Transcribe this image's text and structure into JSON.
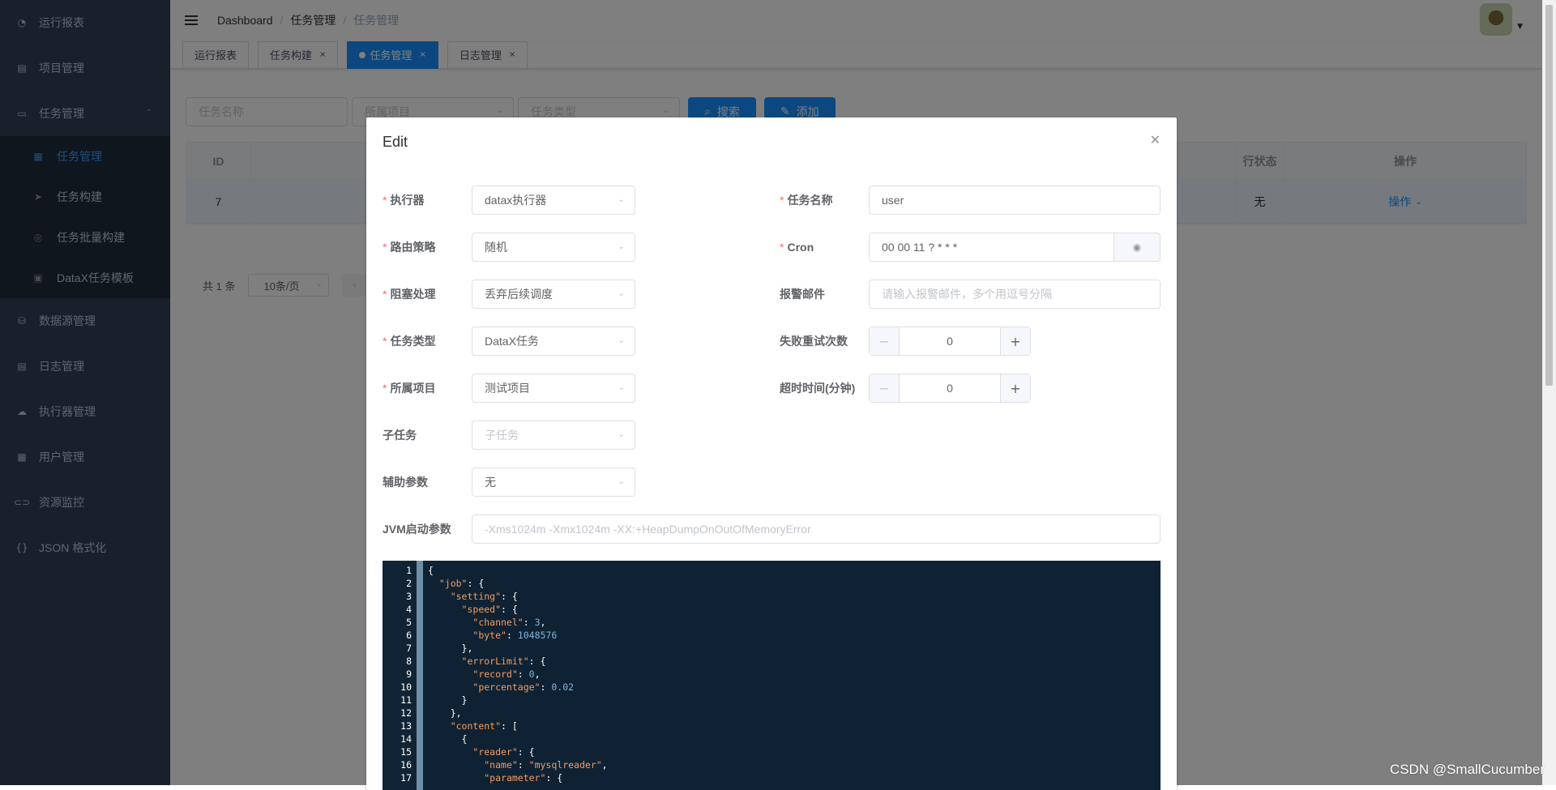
{
  "sidebar": {
    "items": [
      {
        "label": "运行报表",
        "icon": "dashboard-icon"
      },
      {
        "label": "项目管理",
        "icon": "project-icon"
      },
      {
        "label": "任务管理",
        "icon": "monitor-icon",
        "expanded": true
      },
      {
        "label": "数据源管理",
        "icon": "database-icon"
      },
      {
        "label": "日志管理",
        "icon": "document-icon"
      },
      {
        "label": "执行器管理",
        "icon": "cloud-icon"
      },
      {
        "label": "用户管理",
        "icon": "table-icon"
      },
      {
        "label": "资源监控",
        "icon": "link-icon"
      },
      {
        "label": "JSON 格式化",
        "icon": "braces-icon"
      }
    ],
    "submenu": [
      {
        "label": "任务管理",
        "icon": "calculator-icon",
        "active": true
      },
      {
        "label": "任务构建",
        "icon": "send-icon"
      },
      {
        "label": "任务批量构建",
        "icon": "gauge-icon"
      },
      {
        "label": "DataX任务模板",
        "icon": "template-icon"
      }
    ]
  },
  "navbar": {
    "breadcrumb": [
      "Dashboard",
      "任务管理",
      "任务管理"
    ]
  },
  "tags": [
    {
      "label": "运行报表",
      "closable": false
    },
    {
      "label": "任务构建",
      "closable": true
    },
    {
      "label": "任务管理",
      "closable": true,
      "active": true
    },
    {
      "label": "日志管理",
      "closable": true
    }
  ],
  "filter": {
    "name_placeholder": "任务名称",
    "project_placeholder": "所属项目",
    "type_placeholder": "任务类型",
    "search_label": "搜索",
    "add_label": "添加"
  },
  "table": {
    "headers": [
      "ID",
      "",
      "行状态",
      "操作"
    ],
    "rows": [
      {
        "id": "7",
        "status": "无",
        "action": "操作"
      }
    ]
  },
  "pager": {
    "total": "共 1 条",
    "page_size": "10条/页"
  },
  "dialog": {
    "title": "Edit",
    "fields": {
      "executor": {
        "label": "执行器",
        "value": "datax执行器"
      },
      "route": {
        "label": "路由策略",
        "value": "随机"
      },
      "block": {
        "label": "阻塞处理",
        "value": "丢弃后续调度"
      },
      "task_type": {
        "label": "任务类型",
        "value": "DataX任务"
      },
      "project": {
        "label": "所属项目",
        "value": "测试项目"
      },
      "child": {
        "label": "子任务",
        "placeholder": "子任务"
      },
      "aux": {
        "label": "辅助参数",
        "value": "无"
      },
      "jvm": {
        "label": "JVM启动参数",
        "placeholder": "-Xms1024m -Xmx1024m -XX:+HeapDumpOnOutOfMemoryError"
      },
      "task_name": {
        "label": "任务名称",
        "value": "user"
      },
      "cron": {
        "label": "Cron",
        "value": "00 00 11 ? * * *"
      },
      "email": {
        "label": "报警邮件",
        "placeholder": "请输入报警邮件，多个用逗号分隔"
      },
      "retry": {
        "label": "失败重试次数",
        "value": "0"
      },
      "timeout": {
        "label": "超时时间(分钟)",
        "value": "0"
      }
    }
  },
  "editor": {
    "lines": [
      {
        "n": "1",
        "code": "{"
      },
      {
        "n": "2",
        "code": "  \"job\": {"
      },
      {
        "n": "3",
        "code": "    \"setting\": {"
      },
      {
        "n": "4",
        "code": "      \"speed\": {"
      },
      {
        "n": "5",
        "code": "        \"channel\": 3,"
      },
      {
        "n": "6",
        "code": "        \"byte\": 1048576"
      },
      {
        "n": "7",
        "code": "      },"
      },
      {
        "n": "8",
        "code": "      \"errorLimit\": {"
      },
      {
        "n": "9",
        "code": "        \"record\": 0,"
      },
      {
        "n": "10",
        "code": "        \"percentage\": 0.02"
      },
      {
        "n": "11",
        "code": "      }"
      },
      {
        "n": "12",
        "code": "    },"
      },
      {
        "n": "13",
        "code": "    \"content\": ["
      },
      {
        "n": "14",
        "code": "      {"
      },
      {
        "n": "15",
        "code": "        \"reader\": {"
      },
      {
        "n": "16",
        "code": "          \"name\": \"mysqlreader\","
      },
      {
        "n": "17",
        "code": "          \"parameter\": {"
      }
    ]
  },
  "watermark": "CSDN @SmallCucumber"
}
